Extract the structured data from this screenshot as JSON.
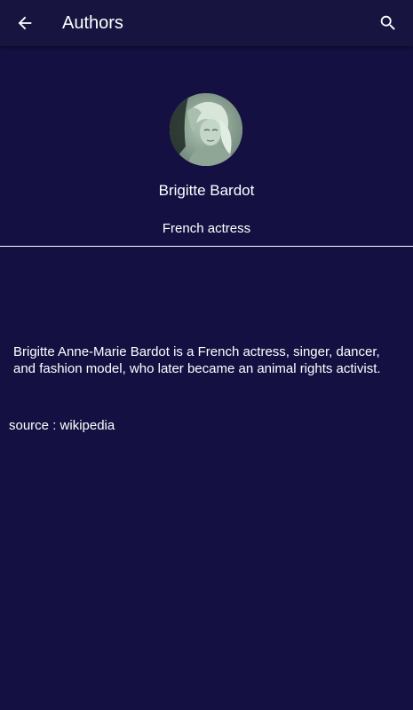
{
  "app_bar": {
    "title": "Authors",
    "back_icon": "arrow-left-icon",
    "search_icon": "search-icon"
  },
  "author": {
    "name": "Brigitte Bardot",
    "role": "French actress",
    "bio": "Brigitte Anne-Marie Bardot is a French actress, singer, dancer, and fashion model, who later became an animal rights activist.",
    "source": "source : wikipedia"
  },
  "colors": {
    "background": "#141142",
    "app_bar": "#17143f",
    "text": "#ffffff",
    "divider": "#ffffff"
  }
}
